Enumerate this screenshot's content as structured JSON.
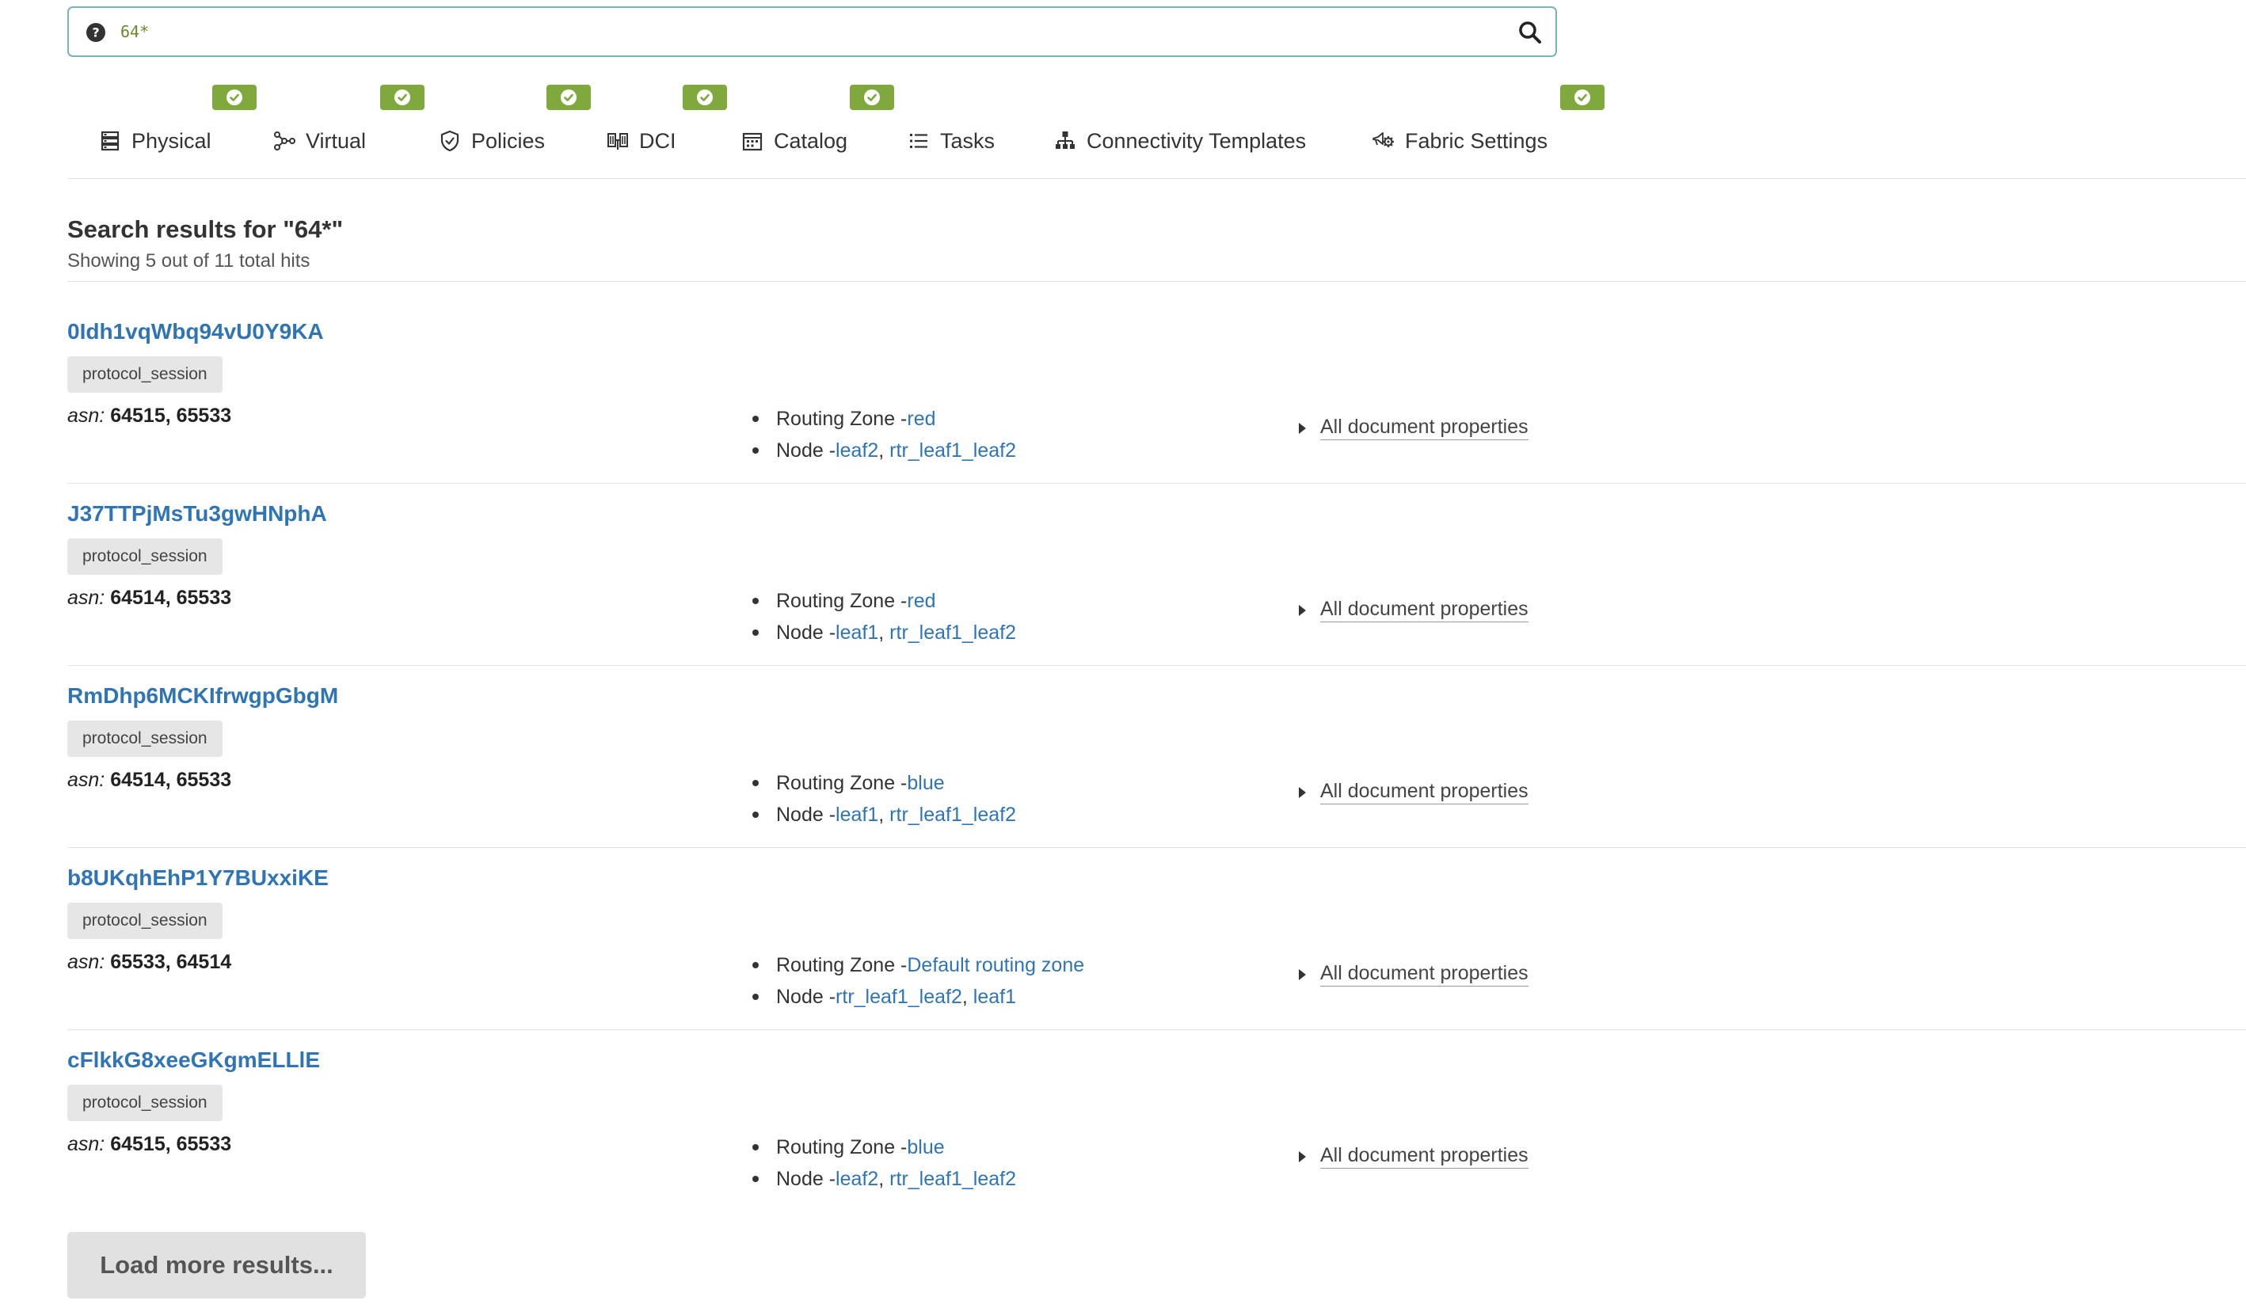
{
  "search": {
    "value": "64*",
    "placeholder": ""
  },
  "tabs": [
    {
      "label": "Physical",
      "icon": "server-rack-icon",
      "has_badge": true
    },
    {
      "label": "Virtual",
      "icon": "network-nodes-icon",
      "has_badge": true
    },
    {
      "label": "Policies",
      "icon": "shield-icon",
      "has_badge": true
    },
    {
      "label": "DCI",
      "icon": "dci-icon",
      "has_badge": true
    },
    {
      "label": "Catalog",
      "icon": "calendar-icon",
      "has_badge": true
    },
    {
      "label": "Tasks",
      "icon": "list-icon",
      "has_badge": false
    },
    {
      "label": "Connectivity Templates",
      "icon": "hierarchy-icon",
      "has_badge": false
    },
    {
      "label": "Fabric Settings",
      "icon": "megaphone-gear-icon",
      "has_badge": true
    }
  ],
  "results": {
    "title": "Search results for \"64*\"",
    "subtitle": "Showing 5 out of 11 total hits",
    "items": [
      {
        "id": "0Idh1vqWbq94vU0Y9KA",
        "type": "protocol_session",
        "asn_key": "asn:",
        "asn_value": "64515, 65533",
        "routing_zone_label": "Routing Zone - ",
        "routing_zone": "red",
        "node_label": "Node - ",
        "nodes": [
          "leaf2",
          "rtr_leaf1_leaf2"
        ],
        "all_props_label": "All document properties"
      },
      {
        "id": "J37TTPjMsTu3gwHNphA",
        "type": "protocol_session",
        "asn_key": "asn:",
        "asn_value": "64514, 65533",
        "routing_zone_label": "Routing Zone - ",
        "routing_zone": "red",
        "node_label": "Node - ",
        "nodes": [
          "leaf1",
          "rtr_leaf1_leaf2"
        ],
        "all_props_label": "All document properties"
      },
      {
        "id": "RmDhp6MCKIfrwgpGbgM",
        "type": "protocol_session",
        "asn_key": "asn:",
        "asn_value": "64514, 65533",
        "routing_zone_label": "Routing Zone - ",
        "routing_zone": "blue",
        "node_label": "Node - ",
        "nodes": [
          "leaf1",
          "rtr_leaf1_leaf2"
        ],
        "all_props_label": "All document properties"
      },
      {
        "id": "b8UKqhEhP1Y7BUxxiKE",
        "type": "protocol_session",
        "asn_key": "asn:",
        "asn_value": "65533, 64514",
        "routing_zone_label": "Routing Zone - ",
        "routing_zone": "Default routing zone",
        "node_label": "Node - ",
        "nodes": [
          "rtr_leaf1_leaf2",
          "leaf1"
        ],
        "all_props_label": "All document properties"
      },
      {
        "id": "cFlkkG8xeeGKgmELLlE",
        "type": "protocol_session",
        "asn_key": "asn:",
        "asn_value": "64515, 65533",
        "routing_zone_label": "Routing Zone - ",
        "routing_zone": "blue",
        "node_label": "Node - ",
        "nodes": [
          "leaf2",
          "rtr_leaf1_leaf2"
        ],
        "all_props_label": "All document properties"
      }
    ]
  },
  "load_more_label": "Load more results...",
  "colors": {
    "accent_link": "#2f74b5",
    "badge_green": "#7fa93d",
    "search_border": "#74b6b2"
  }
}
